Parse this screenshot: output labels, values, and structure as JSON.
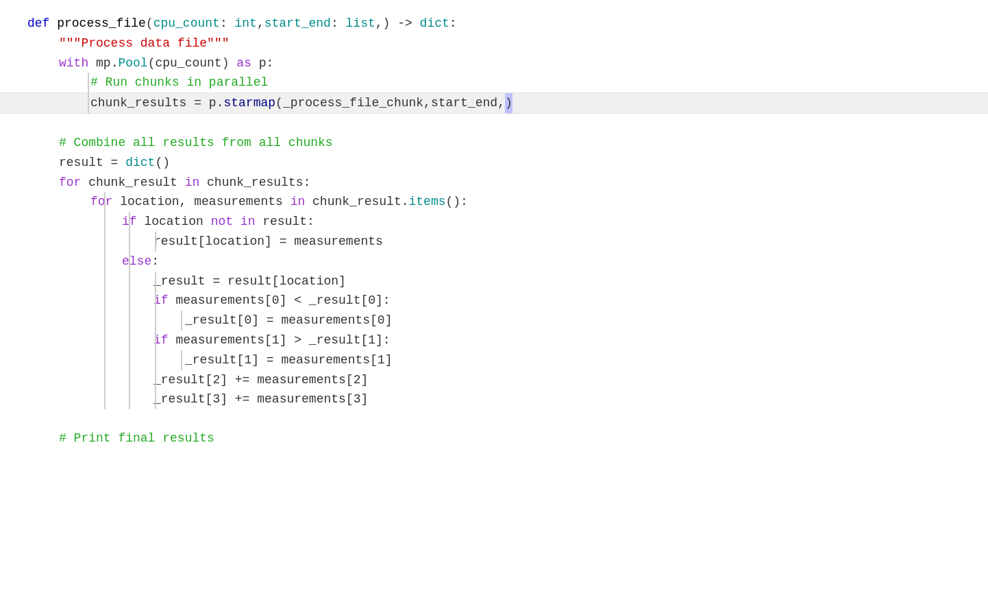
{
  "code": {
    "lines": [
      {
        "id": "line1",
        "indent": 0,
        "tokens": [
          {
            "type": "kw-def",
            "text": "def"
          },
          {
            "type": "plain",
            "text": " "
          },
          {
            "type": "fn-name",
            "text": "process_file"
          },
          {
            "type": "plain",
            "text": "("
          },
          {
            "type": "param",
            "text": "cpu_count"
          },
          {
            "type": "plain",
            "text": ": "
          },
          {
            "type": "type-hint",
            "text": "int"
          },
          {
            "type": "plain",
            "text": ","
          },
          {
            "type": "param",
            "text": "start_end"
          },
          {
            "type": "plain",
            "text": ": "
          },
          {
            "type": "type-hint",
            "text": "list"
          },
          {
            "type": "plain",
            "text": ",) "
          },
          {
            "type": "arrow",
            "text": "->"
          },
          {
            "type": "plain",
            "text": " "
          },
          {
            "type": "type-hint",
            "text": "dict"
          },
          {
            "type": "plain",
            "text": ":"
          }
        ],
        "highlighted": false,
        "bars": []
      },
      {
        "id": "line2",
        "indent": 4,
        "tokens": [
          {
            "type": "string",
            "text": "\"\"\"Process data file\"\"\""
          }
        ],
        "highlighted": false,
        "bars": []
      },
      {
        "id": "line3",
        "indent": 4,
        "tokens": [
          {
            "type": "kw-keyword",
            "text": "with"
          },
          {
            "type": "plain",
            "text": " "
          },
          {
            "type": "plain",
            "text": "mp."
          },
          {
            "type": "builtin",
            "text": "Pool"
          },
          {
            "type": "plain",
            "text": "(cpu_count) "
          },
          {
            "type": "kw-keyword",
            "text": "as"
          },
          {
            "type": "plain",
            "text": " p:"
          }
        ],
        "highlighted": false,
        "bars": []
      },
      {
        "id": "line4",
        "indent": 8,
        "tokens": [
          {
            "type": "comment",
            "text": "# Run chunks in parallel"
          }
        ],
        "highlighted": false,
        "bars": [
          "bar1"
        ]
      },
      {
        "id": "line5",
        "indent": 8,
        "tokens": [
          {
            "type": "plain",
            "text": "chunk_results = p."
          },
          {
            "type": "method",
            "text": "starmap"
          },
          {
            "type": "plain",
            "text": "("
          },
          {
            "type": "plain",
            "text": "_process_file_chunk,start_end,"
          },
          {
            "type": "bracket-highlight",
            "text": ")"
          }
        ],
        "highlighted": true,
        "bars": [
          "bar1"
        ]
      },
      {
        "id": "line6",
        "indent": 0,
        "tokens": [],
        "highlighted": false,
        "bars": []
      },
      {
        "id": "line7",
        "indent": 4,
        "tokens": [
          {
            "type": "comment",
            "text": "# Combine all results from all chunks"
          }
        ],
        "highlighted": false,
        "bars": []
      },
      {
        "id": "line8",
        "indent": 4,
        "tokens": [
          {
            "type": "plain",
            "text": "result = "
          },
          {
            "type": "builtin",
            "text": "dict"
          },
          {
            "type": "plain",
            "text": "()"
          }
        ],
        "highlighted": false,
        "bars": []
      },
      {
        "id": "line9",
        "indent": 4,
        "tokens": [
          {
            "type": "kw-keyword",
            "text": "for"
          },
          {
            "type": "plain",
            "text": " chunk_result "
          },
          {
            "type": "kw-keyword",
            "text": "in"
          },
          {
            "type": "plain",
            "text": " chunk_results:"
          }
        ],
        "highlighted": false,
        "bars": []
      },
      {
        "id": "line10",
        "indent": 8,
        "tokens": [
          {
            "type": "kw-keyword",
            "text": "for"
          },
          {
            "type": "plain",
            "text": " location, measurements "
          },
          {
            "type": "kw-keyword",
            "text": "in"
          },
          {
            "type": "plain",
            "text": " chunk_result."
          },
          {
            "type": "builtin",
            "text": "items"
          },
          {
            "type": "plain",
            "text": "():"
          }
        ],
        "highlighted": false,
        "bars": [
          "bar2"
        ]
      },
      {
        "id": "line11",
        "indent": 12,
        "tokens": [
          {
            "type": "kw-keyword",
            "text": "if"
          },
          {
            "type": "plain",
            "text": " location "
          },
          {
            "type": "kw-keyword",
            "text": "not"
          },
          {
            "type": "plain",
            "text": " "
          },
          {
            "type": "kw-keyword",
            "text": "in"
          },
          {
            "type": "plain",
            "text": " result:"
          }
        ],
        "highlighted": false,
        "bars": [
          "bar2",
          "bar3"
        ]
      },
      {
        "id": "line12",
        "indent": 16,
        "tokens": [
          {
            "type": "plain",
            "text": "result[location] = measurements"
          }
        ],
        "highlighted": false,
        "bars": [
          "bar2",
          "bar3",
          "bar4"
        ]
      },
      {
        "id": "line13",
        "indent": 12,
        "tokens": [
          {
            "type": "kw-keyword",
            "text": "else"
          },
          {
            "type": "plain",
            "text": ":"
          }
        ],
        "highlighted": false,
        "bars": [
          "bar2",
          "bar3"
        ]
      },
      {
        "id": "line14",
        "indent": 16,
        "tokens": [
          {
            "type": "plain",
            "text": "_result = result[location]"
          }
        ],
        "highlighted": false,
        "bars": [
          "bar2",
          "bar3",
          "bar4"
        ]
      },
      {
        "id": "line15",
        "indent": 16,
        "tokens": [
          {
            "type": "kw-keyword",
            "text": "if"
          },
          {
            "type": "plain",
            "text": " measurements[0] < _result[0]:"
          }
        ],
        "highlighted": false,
        "bars": [
          "bar2",
          "bar3",
          "bar4"
        ]
      },
      {
        "id": "line16",
        "indent": 20,
        "tokens": [
          {
            "type": "plain",
            "text": "_result[0] = measurements[0]"
          }
        ],
        "highlighted": false,
        "bars": [
          "bar2",
          "bar3",
          "bar4",
          "bar5"
        ]
      },
      {
        "id": "line17",
        "indent": 16,
        "tokens": [
          {
            "type": "kw-keyword",
            "text": "if"
          },
          {
            "type": "plain",
            "text": " measurements[1] > _result[1]:"
          }
        ],
        "highlighted": false,
        "bars": [
          "bar2",
          "bar3",
          "bar4"
        ]
      },
      {
        "id": "line18",
        "indent": 20,
        "tokens": [
          {
            "type": "plain",
            "text": "_result[1] = measurements[1]"
          }
        ],
        "highlighted": false,
        "bars": [
          "bar2",
          "bar3",
          "bar4",
          "bar5"
        ]
      },
      {
        "id": "line19",
        "indent": 16,
        "tokens": [
          {
            "type": "plain",
            "text": "_result[2] += measurements[2]"
          }
        ],
        "highlighted": false,
        "bars": [
          "bar2",
          "bar3",
          "bar4"
        ]
      },
      {
        "id": "line20",
        "indent": 16,
        "tokens": [
          {
            "type": "plain",
            "text": "_result[3] += measurements[3]"
          }
        ],
        "highlighted": false,
        "bars": [
          "bar2",
          "bar3",
          "bar4"
        ]
      },
      {
        "id": "line21",
        "indent": 0,
        "tokens": [],
        "highlighted": false,
        "bars": []
      },
      {
        "id": "line22",
        "indent": 4,
        "tokens": [
          {
            "type": "comment",
            "text": "# Print final results"
          }
        ],
        "highlighted": false,
        "bars": []
      }
    ]
  }
}
